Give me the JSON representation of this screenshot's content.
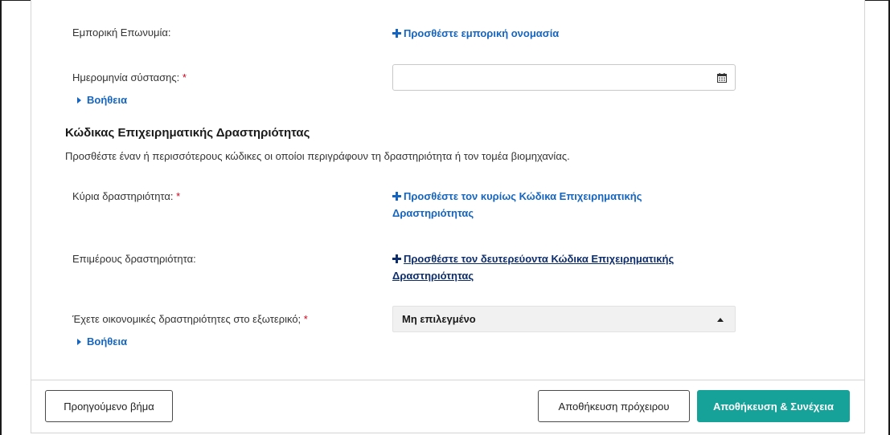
{
  "form": {
    "trade_name": {
      "label": "Εμπορική Επωνυμία:",
      "add_link": "Προσθέστε εμπορική ονομασία"
    },
    "founding_date": {
      "label": "Ημερομηνία σύστασης:",
      "required_mark": "*",
      "value": "",
      "help_label": "Βοήθεια"
    },
    "activity_code_section": {
      "title": "Κώδικας Επιχειρηματικής Δραστηριότητας",
      "description": "Προσθέστε έναν ή περισσότερους κώδικες οι οποίοι περιγράφουν τη δραστηριότητα ή τον τομέα βιομηχανίας."
    },
    "main_activity": {
      "label": "Κύρια δραστηριότητα:",
      "required_mark": "*",
      "add_link_line1": "Προσθέστε τον κυρίως Κώδικα Επιχειρηματικής",
      "add_link_line2": "Δραστηριότητας"
    },
    "secondary_activity": {
      "label": "Επιμέρους δραστηριότητα:",
      "add_link_line1": "Προσθέστε τον δευτερεύοντα Κώδικα Επιχειρηματικής",
      "add_link_line2": "Δραστηριότητας"
    },
    "foreign_activities": {
      "label": "Έχετε οικονομικές δραστηριότητες στο εξωτερικό;",
      "required_mark": "*",
      "selected_value": "Μη επιλεγμένο",
      "help_label": "Βοήθεια"
    }
  },
  "footer": {
    "previous_label": "Προηγούμενο βήμα",
    "save_draft_label": "Αποθήκευση πρόχειρου",
    "save_continue_label": "Αποθήκευση & Συνέχεια"
  },
  "icons": {
    "calendar": "calendar-icon",
    "plus": "plus-icon",
    "expand": "caret-right-icon",
    "dropdown": "caret-up-icon"
  },
  "colors": {
    "link": "#1565c0",
    "required": "#d0021b",
    "primary_button": "#16a199"
  }
}
